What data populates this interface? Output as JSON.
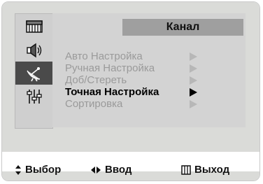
{
  "window": {
    "title": "Канал"
  },
  "sidebar": {
    "items": [
      {
        "icon": "tv-picture-icon",
        "active": false
      },
      {
        "icon": "speaker-sound-icon",
        "active": false
      },
      {
        "icon": "satellite-channel-icon",
        "active": true
      },
      {
        "icon": "equalizer-settings-icon",
        "active": false
      },
      {
        "icon": "blank",
        "active": false
      }
    ]
  },
  "menu": {
    "items": [
      {
        "label": "Авто Настройка",
        "selected": false
      },
      {
        "label": "Ручная Настройка",
        "selected": false
      },
      {
        "label": "Доб/Стереть",
        "selected": false
      },
      {
        "label": "Точная Настройка",
        "selected": true
      },
      {
        "label": "Сортировка",
        "selected": false
      }
    ]
  },
  "footer": {
    "select_label": "Выбор",
    "enter_label": "Ввод",
    "exit_label": "Выход"
  },
  "colors": {
    "background": "#dadbd8",
    "panel": "#d3d3d3",
    "title_bar": "#9f9f9f",
    "inactive_text": "#9a9a9a",
    "selected_text": "#000000",
    "active_sidebar": "#4a4a4a"
  }
}
